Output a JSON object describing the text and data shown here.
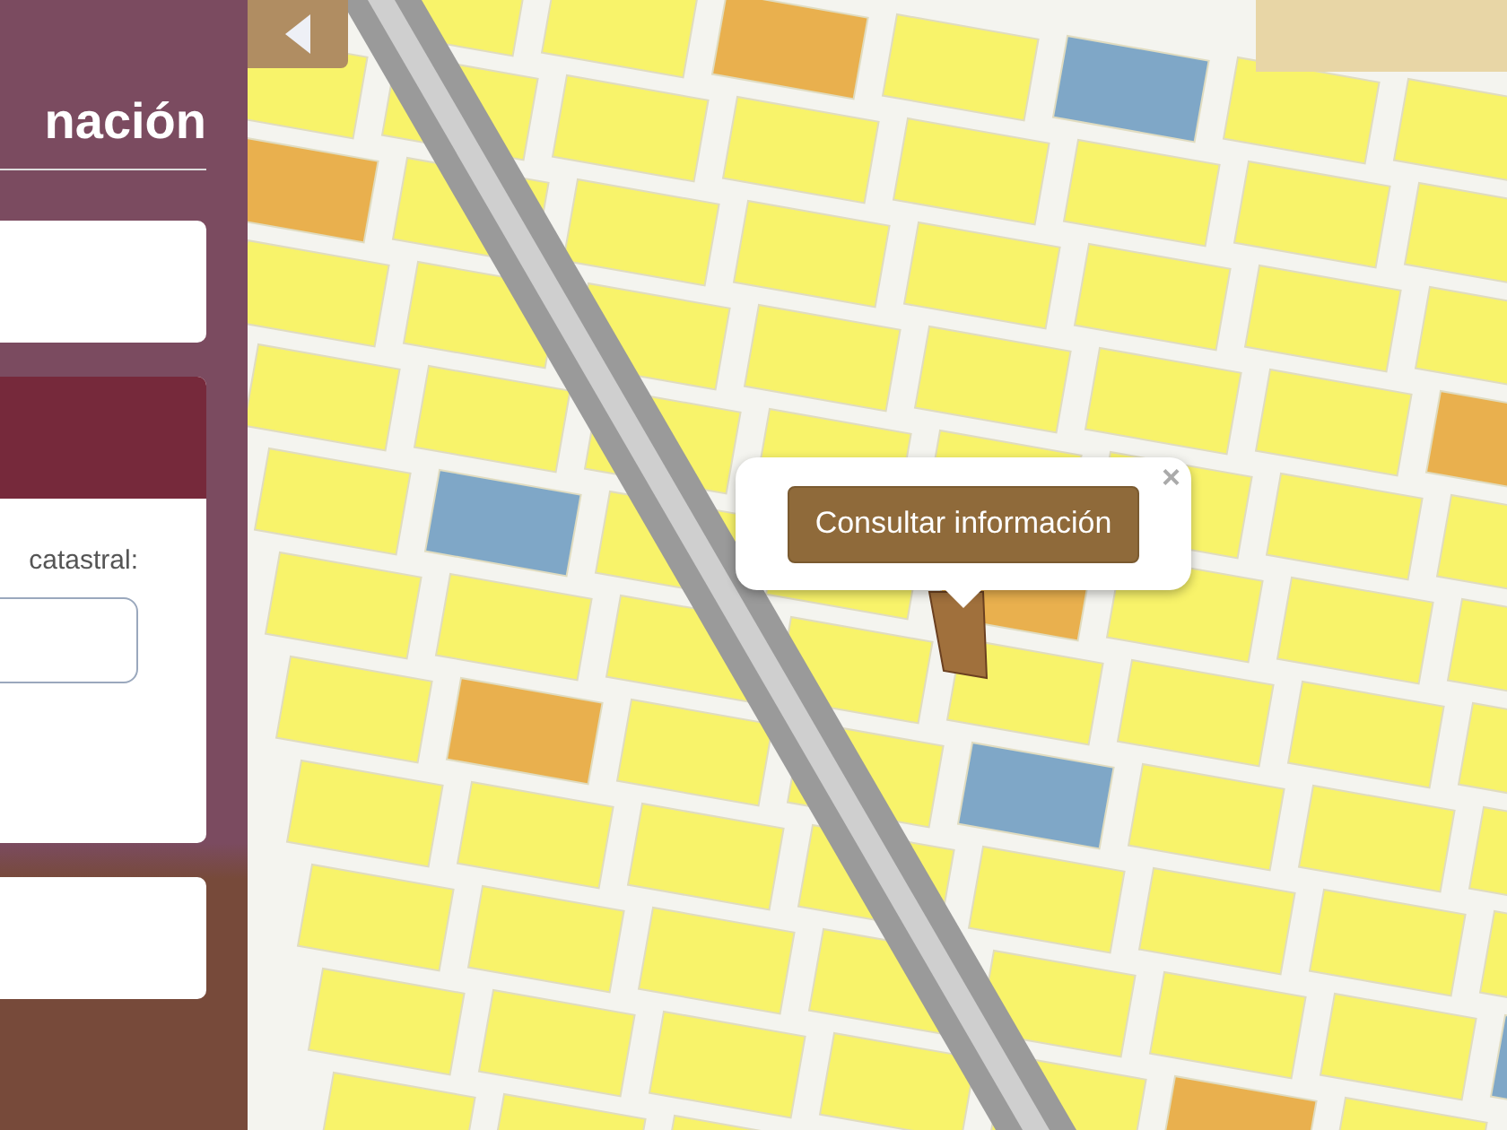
{
  "sidebar": {
    "title": "nación",
    "cards": [
      {
        "kind": "blank"
      },
      {
        "kind": "form",
        "label": "catastral:"
      },
      {
        "kind": "blank"
      }
    ]
  },
  "map": {
    "popup": {
      "button": "Consultar información",
      "close": "×"
    }
  }
}
